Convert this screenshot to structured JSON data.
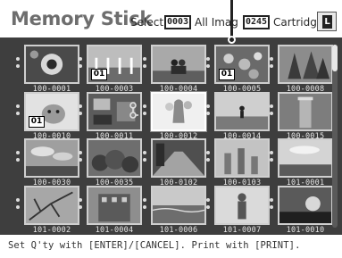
{
  "header": {
    "title": "Memory Stick",
    "select_label": "Select",
    "selected_count": "0003",
    "all_images_label": "All Imag",
    "total_count": "0245",
    "cartridge_label": "Cartridge",
    "cartridge_size": "L"
  },
  "grid": {
    "images": [
      {
        "label": "100-0001",
        "qty": "",
        "scene": "flower"
      },
      {
        "label": "100-0003",
        "qty": "01",
        "scene": "fence"
      },
      {
        "label": "100-0004",
        "qty": "",
        "scene": "couple"
      },
      {
        "label": "100-0005",
        "qty": "01",
        "scene": "pinkflowers"
      },
      {
        "label": "100-0008",
        "qty": "",
        "scene": "trees"
      },
      {
        "label": "100-0010",
        "qty": "01",
        "scene": "dog"
      },
      {
        "label": "100-0011",
        "qty": "",
        "scene": "room"
      },
      {
        "label": "100-0012",
        "qty": "",
        "scene": "vase"
      },
      {
        "label": "100-0014",
        "qty": "",
        "scene": "playground"
      },
      {
        "label": "100-0015",
        "qty": "",
        "scene": "pillar"
      },
      {
        "label": "100-0030",
        "qty": "",
        "scene": "clouds"
      },
      {
        "label": "100-0035",
        "qty": "",
        "scene": "bushes"
      },
      {
        "label": "100-0102",
        "qty": "",
        "scene": "street"
      },
      {
        "label": "100-0103",
        "qty": "",
        "scene": "ruins"
      },
      {
        "label": "101-0001",
        "qty": "",
        "scene": "sky"
      },
      {
        "label": "101-0002",
        "qty": "",
        "scene": "branches"
      },
      {
        "label": "101-0004",
        "qty": "",
        "scene": "building"
      },
      {
        "label": "101-0006",
        "qty": "",
        "scene": "ocean"
      },
      {
        "label": "101-0007",
        "qty": "",
        "scene": "statue"
      },
      {
        "label": "101-0010",
        "qty": "",
        "scene": "sunset"
      }
    ]
  },
  "footer": {
    "hint": "Set Q'ty with [ENTER]/[CANCEL]. Print with [PRINT]."
  },
  "colors": {
    "panel": "#3e3e3e",
    "title": "#6e6e6e",
    "label_text": "#e6e6e6"
  },
  "icons": [
    "cartridge-size-icon",
    "protect-key-icon",
    "scroll-thumb"
  ]
}
